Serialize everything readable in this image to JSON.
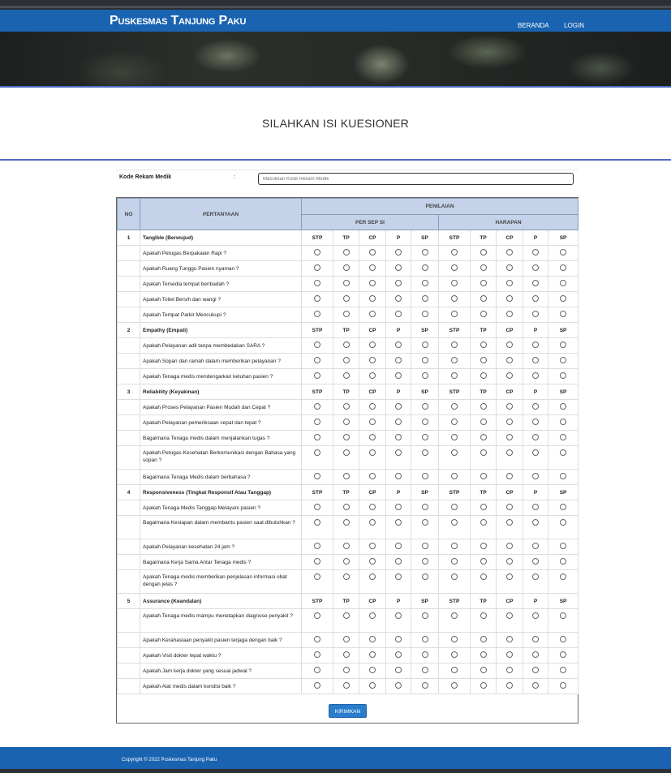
{
  "header": {
    "brand": "Puskesmas Tanjung Paku",
    "nav": [
      "BERANDA",
      "LOGIN"
    ]
  },
  "page": {
    "title": "SILAHKAN ISI KUESIONER"
  },
  "form": {
    "label": "Kode Rekam Medik",
    "separator": ":",
    "placeholder": "Masukkan Kode Rekam Medik"
  },
  "table": {
    "head_no": "NO",
    "head_question": "PERTANYAAN",
    "head_rating": "PENILAIAN",
    "head_perception": "PER SEP SI",
    "head_expectation": "HARAPAN",
    "scale": [
      "STP",
      "TP",
      "CP",
      "P",
      "SP"
    ],
    "sections": [
      {
        "no": "1",
        "title": "Tangible (Berwujud)",
        "questions": [
          "Apakah Petugas Berpakaian Rapi ?",
          "Apakah Ruang Tunggu Pasien nyaman ?",
          "Apakah Tersedia tempat beribadah ?",
          "Apakah Toilet Bersih dan wangi ?",
          "Apakah Tempat Parkir Mencukupi ?"
        ]
      },
      {
        "no": "2",
        "title": "Empathy (Empati)",
        "questions": [
          "Apakah Pelayanan adil tanpa membedakan SARA ?",
          "Apakah Sopan dan ramah dalam memberikan pelayanan ?",
          "Apakah Tenaga medis mendengarkan keluhan pasien ?"
        ]
      },
      {
        "no": "3",
        "title": "Reliability (Keyakinan)",
        "questions": [
          "Apakah Proses Pelayanan Pasien Mudah dan Cepat ?",
          "Apakah Pelayanan pemeriksaan cepat dan tepat ?",
          "Bagaimana Tenaga medis dalam menjalankan tugas ?",
          "Apakah Petugas Kesehatan Berkomunikasi dengan Bahasa yang sopan ?",
          "Bagaimana Tenaga Medis dalam berbahasa ?"
        ]
      },
      {
        "no": "4",
        "title": "Responsiveness (Tingkat Responsif Atau Tanggap)",
        "questions": [
          "Apakah Tenaga Medis Tanggap Melayani pasien ?",
          "Bagaimana Kesiapan dalam membantu pasien saat dibutuhkan ?",
          "Apakah Pelayanan kesehatan 24 jam ?",
          "Bagaimana Kerja Sama Antar Tenaga medis ?",
          "Apakah Tenaga medis memberikan penjelasan informasi obat dengan jelas ?"
        ]
      },
      {
        "no": "5",
        "title": "Assurance (Keandalan)",
        "questions": [
          "Apakah Tenaga medis mampu menetapkan diagnose penyakit ?",
          "Apakah Kerahasiaan penyakit pasien terjaga dengan baik ?",
          "Apakah Visit dokter tepat waktu ?",
          "Apakah Jam kerja dokter yang sesuai jadwal ?",
          "Apakah Alat medis dalam kondisi baik ?"
        ]
      }
    ]
  },
  "submit_label": "KIRIMKAN",
  "footer": {
    "text": "Copyright © 2022 Puskesmas Tanjung Paku"
  }
}
